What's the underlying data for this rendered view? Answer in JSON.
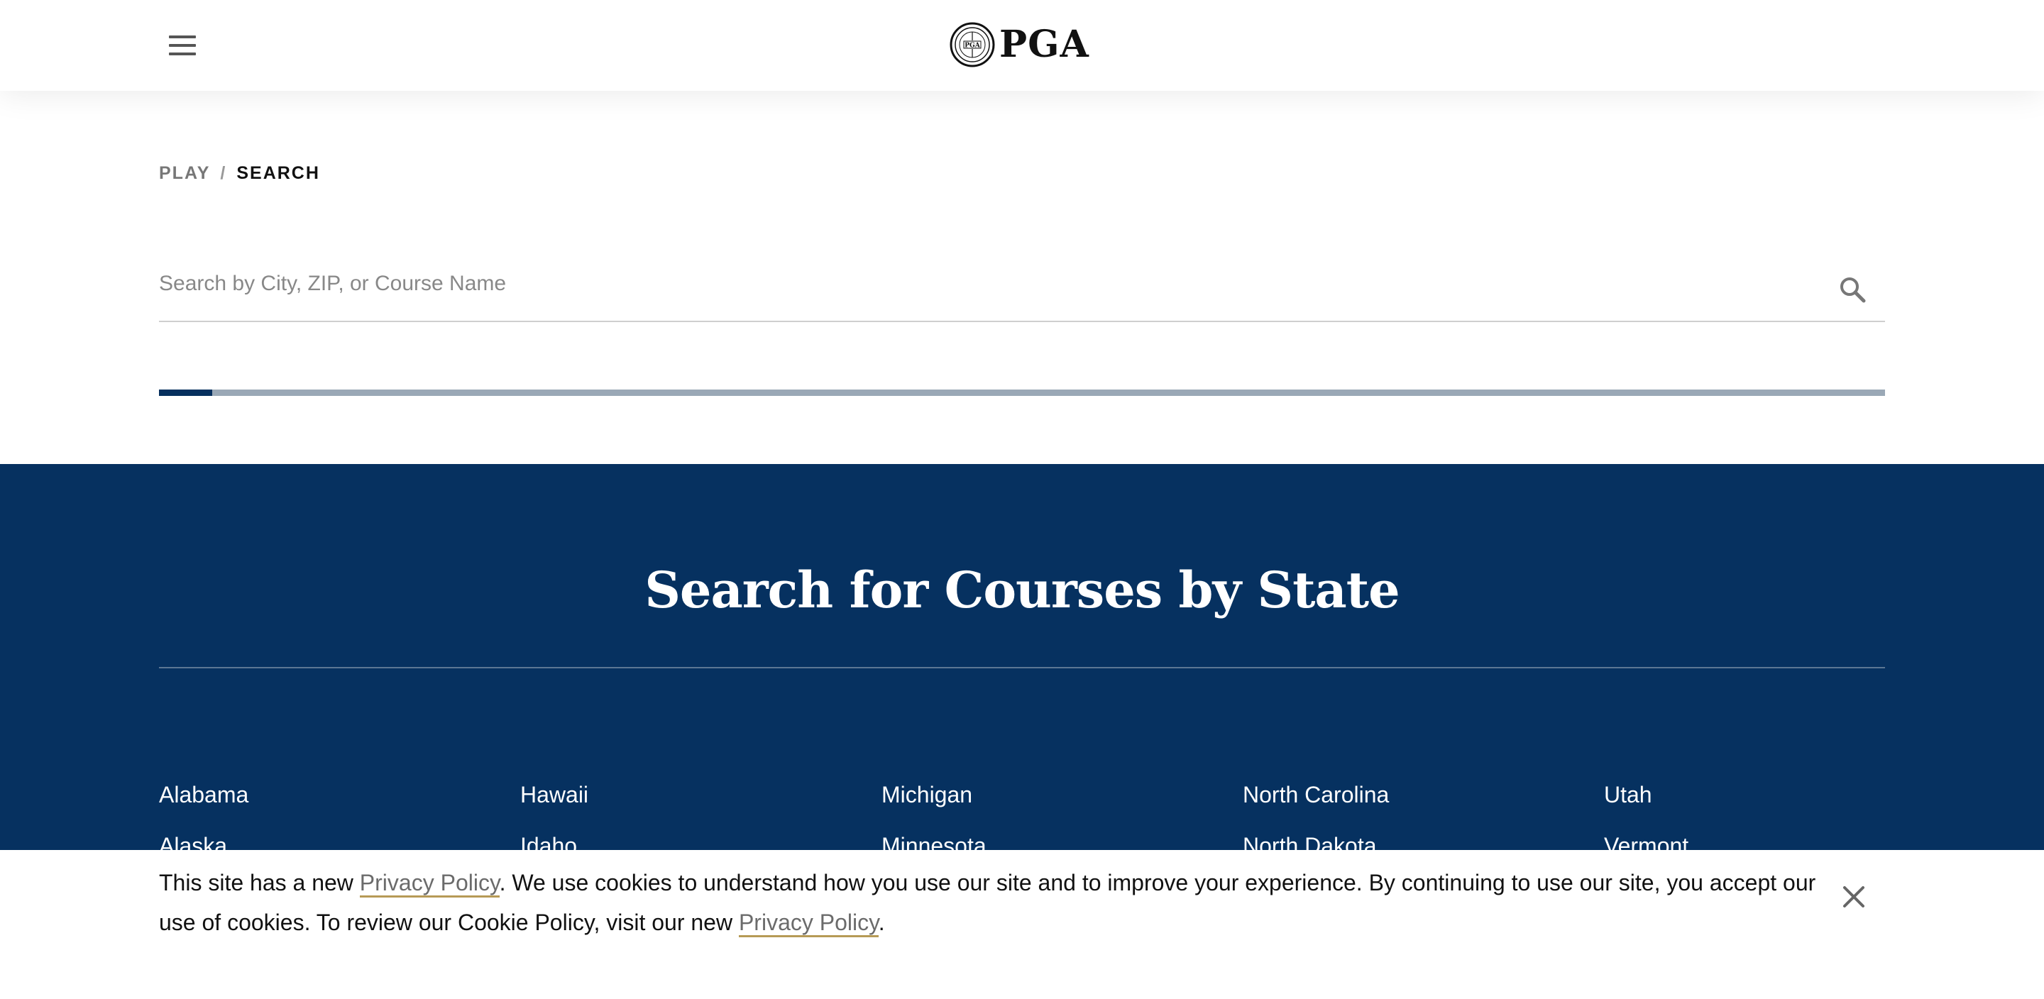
{
  "header": {
    "menu_icon": "hamburger-menu-icon",
    "logo_icon": "pga-seal-icon",
    "logo_text": "PGA"
  },
  "breadcrumb": {
    "parent": "PLAY",
    "separator": "/",
    "current": "SEARCH"
  },
  "search": {
    "value": "",
    "placeholder": "Search by City, ZIP, or Course Name",
    "icon": "search-icon"
  },
  "progress": {
    "fraction": 0.031
  },
  "states_section": {
    "title": "Search for Courses by State",
    "columns": [
      [
        "Alabama",
        "Alaska"
      ],
      [
        "Hawaii",
        "Idaho"
      ],
      [
        "Michigan",
        "Minnesota"
      ],
      [
        "North Carolina",
        "North Dakota"
      ],
      [
        "Utah",
        "Vermont"
      ]
    ]
  },
  "cookie_banner": {
    "text_1": "This site has a new ",
    "link_1": "Privacy Policy",
    "text_2": ". We use cookies to understand how you use our site and to improve your experience. By continuing to use our site, you accept our use of cookies. To review our Cookie Policy, visit our new ",
    "link_2": "Privacy Policy",
    "text_3": ".",
    "close_icon": "close-icon"
  },
  "colors": {
    "navy": "#063160",
    "progress_track": "#9aa8b6",
    "link_underline": "#b69a56"
  }
}
